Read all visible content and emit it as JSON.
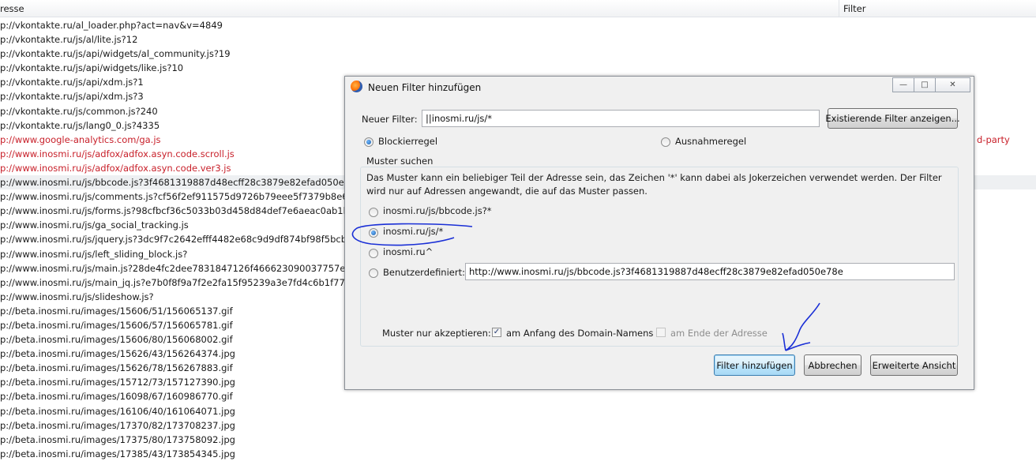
{
  "list": {
    "col_address": "resse",
    "col_filter": "Filter",
    "rows": [
      {
        "text": "p://vkontakte.ru/al_loader.php?act=nav&v=4849",
        "style": ""
      },
      {
        "text": "p://vkontakte.ru/js/al/lite.js?12",
        "style": ""
      },
      {
        "text": "p://vkontakte.ru/js/api/widgets/al_community.js?19",
        "style": ""
      },
      {
        "text": "p://vkontakte.ru/js/api/widgets/like.js?10",
        "style": ""
      },
      {
        "text": "p://vkontakte.ru/js/api/xdm.js?1",
        "style": ""
      },
      {
        "text": "p://vkontakte.ru/js/api/xdm.js?3",
        "style": ""
      },
      {
        "text": "p://vkontakte.ru/js/common.js?240",
        "style": ""
      },
      {
        "text": "p://vkontakte.ru/js/lang0_0.js?4335",
        "style": ""
      },
      {
        "text": "p://www.google-analytics.com/ga.js",
        "style": "red",
        "extra": "d-party"
      },
      {
        "text": "p://www.inosmi.ru/js/adfox/adfox.asyn.code.scroll.js",
        "style": "red"
      },
      {
        "text": "p://www.inosmi.ru/js/adfox/adfox.asyn.code.ver3.js",
        "style": "red"
      },
      {
        "text": "p://www.inosmi.ru/js/bbcode.js?3f4681319887d48ecff28c3879e82efad050e78e",
        "style": "sel"
      },
      {
        "text": "p://www.inosmi.ru/js/comments.js?cf56f2ef911575d9726b79eee5f7379b8e6bfe08",
        "style": ""
      },
      {
        "text": "p://www.inosmi.ru/js/forms.js?98cfbcf36c5033b03d458d84def7e6aeac0ab1b9",
        "style": ""
      },
      {
        "text": "p://www.inosmi.ru/js/ga_social_tracking.js",
        "style": ""
      },
      {
        "text": "p://www.inosmi.ru/js/jquery.js?3dc9f7c2642efff4482e68c9d9df874bf98f5bcb",
        "style": ""
      },
      {
        "text": "p://www.inosmi.ru/js/left_sliding_block.js?",
        "style": ""
      },
      {
        "text": "p://www.inosmi.ru/js/main.js?28de4fc2dee7831847126f466623090037757ea2",
        "style": ""
      },
      {
        "text": "p://www.inosmi.ru/js/main_jq.js?e7b0f8f9a7f2e2fa15f95239a3e7fd4c6b1f77a4",
        "style": ""
      },
      {
        "text": "p://www.inosmi.ru/js/slideshow.js?",
        "style": ""
      },
      {
        "text": "p://beta.inosmi.ru/images/15606/51/156065137.gif",
        "style": ""
      },
      {
        "text": "p://beta.inosmi.ru/images/15606/57/156065781.gif",
        "style": ""
      },
      {
        "text": "p://beta.inosmi.ru/images/15606/80/156068002.gif",
        "style": ""
      },
      {
        "text": "p://beta.inosmi.ru/images/15626/43/156264374.jpg",
        "style": ""
      },
      {
        "text": "p://beta.inosmi.ru/images/15626/78/156267883.gif",
        "style": ""
      },
      {
        "text": "p://beta.inosmi.ru/images/15712/73/157127390.jpg",
        "style": ""
      },
      {
        "text": "p://beta.inosmi.ru/images/16098/67/160986770.gif",
        "style": ""
      },
      {
        "text": "p://beta.inosmi.ru/images/16106/40/161064071.jpg",
        "style": ""
      },
      {
        "text": "p://beta.inosmi.ru/images/17370/82/173708237.jpg",
        "style": ""
      },
      {
        "text": "p://beta.inosmi.ru/images/17375/80/173758092.jpg",
        "style": ""
      },
      {
        "text": "p://beta.inosmi.ru/images/17385/43/173854345.jpg",
        "style": ""
      }
    ]
  },
  "dialog": {
    "title": "Neuen Filter hinzufügen",
    "icon": "firefox-icon",
    "new_filter_label": "Neuer Filter:",
    "new_filter_value": "||inosmi.ru/js/*",
    "show_existing_button": "Existierende Filter anzeigen...",
    "rule_block_label": "Blockierregel",
    "rule_exception_label": "Ausnahmeregel",
    "rule_selected": "block",
    "pattern_group_title": "Muster suchen",
    "pattern_description": "Das Muster kann ein beliebiger Teil der Adresse sein, das Zeichen '*' kann dabei als Jokerzeichen verwendet werden. Der Filter wird nur auf Adressen angewandt, die auf das Muster passen.",
    "pattern_options": [
      {
        "label": "inosmi.ru/js/bbcode.js?*",
        "selected": false
      },
      {
        "label": "inosmi.ru/js/*",
        "selected": true
      },
      {
        "label": "inosmi.ru^",
        "selected": false
      }
    ],
    "custom_label": "Benutzerdefiniert:",
    "custom_value": "http://www.inosmi.ru/js/bbcode.js?3f4681319887d48ecff28c3879e82efad050e78e",
    "accept_label": "Muster nur akzeptieren:",
    "accept_domain_start_label": "am Anfang des Domain-Namens",
    "accept_domain_start_checked": true,
    "accept_address_end_label": "am Ende der Adresse",
    "accept_address_end_checked": false,
    "add_button": "Filter hinzufügen",
    "cancel_button": "Abbrechen",
    "advanced_button": "Erweiterte Ansicht",
    "annotation_color": "#1a2fd6"
  }
}
